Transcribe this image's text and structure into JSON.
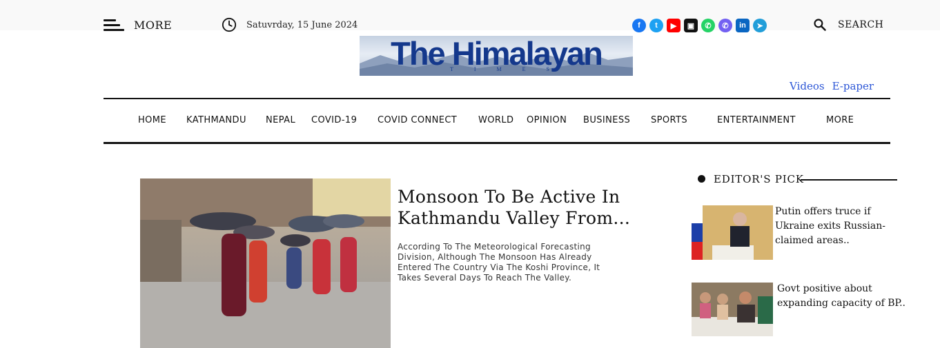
{
  "header": {
    "more_label": "MORE",
    "date": "Satuvrday, 15 June 2024",
    "search_label": "SEARCH",
    "socials": [
      {
        "name": "facebook-icon",
        "color": "#1877f2",
        "glyph": "f"
      },
      {
        "name": "twitter-icon",
        "color": "#1da1f2",
        "glyph": "t"
      },
      {
        "name": "youtube-icon",
        "color": "#ff0000",
        "glyph": "▶"
      },
      {
        "name": "gallery-icon",
        "color": "#111111",
        "glyph": "▣"
      },
      {
        "name": "whatsapp-icon",
        "color": "#25d366",
        "glyph": "✆"
      },
      {
        "name": "viber-icon",
        "color": "#7360f2",
        "glyph": "✆"
      },
      {
        "name": "linkedin-icon",
        "color": "#0a66c2",
        "glyph": "in"
      },
      {
        "name": "telegram-icon",
        "color": "#229ed9",
        "glyph": "➤"
      }
    ]
  },
  "logo": {
    "title": "The Himalayan",
    "subtitle": "TIMES"
  },
  "links": {
    "videos": "Videos",
    "epaper": "E-paper"
  },
  "nav": {
    "items": [
      "HOME",
      "KATHMANDU",
      "NEPAL",
      "COVID-19",
      "COVID CONNECT",
      "WORLD",
      "OPINION",
      "BUSINESS",
      "SPORTS",
      "ENTERTAINMENT",
      "MORE"
    ]
  },
  "lead": {
    "headline": "Monsoon To Be Active In Kathmandu Valley From...",
    "summary": "According To The Meteorological Forecasting Division, Although The Monsoon Has Already Entered The Country Via The Koshi Province, It Takes Several Days To Reach The Valley."
  },
  "editors_pick": {
    "title": "EDITOR'S PICK",
    "items": [
      {
        "text": "Putin offers truce if Ukraine exits Russian-claimed areas.."
      },
      {
        "text": "Govt positive about expanding capacity of BP.."
      }
    ]
  },
  "colors": {
    "brand": "#14388c",
    "link": "#2c56d6",
    "text": "#111111"
  }
}
